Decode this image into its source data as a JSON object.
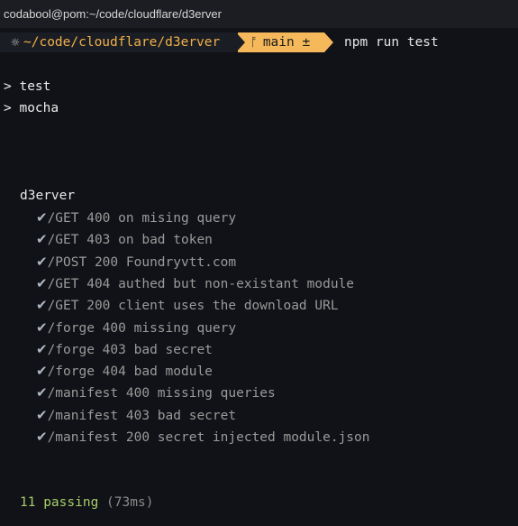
{
  "window": {
    "title": "codabool@pom:~/code/cloudflare/d3erver"
  },
  "prompt": {
    "gear_glyph": "☼",
    "directory": "~/code/cloudflare/d3erver",
    "branch_icon": "branch-icon",
    "branch_glyph": "ᚩ",
    "branch": "main ±",
    "command": "npm run test"
  },
  "output": {
    "line1": "> test",
    "line2": "> mocha"
  },
  "suite": {
    "name": "d3erver",
    "check_glyph": "✔",
    "tests": [
      "/GET 400 on mising query",
      "/GET 403 on bad token",
      "/POST 200 Foundryvtt.com",
      "/GET 404 authed but non-existant module",
      "/GET 200 client uses the download URL",
      "/forge 400 missing query",
      "/forge 403 bad secret",
      "/forge 404 bad module",
      "/manifest 400 missing queries",
      "/manifest 403 bad secret",
      "/manifest 200 secret injected module.json"
    ]
  },
  "summary": {
    "passing": "11 passing",
    "time": "(73ms)"
  },
  "colors": {
    "background": "#101217",
    "titlebar": "#1b1d22",
    "directory": "#f0b04a",
    "git_segment": "#f5b85a",
    "passing": "#a8cc6a"
  }
}
